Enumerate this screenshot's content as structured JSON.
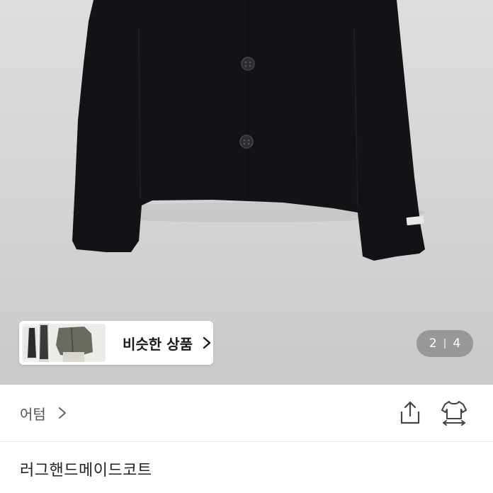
{
  "colors": {
    "jacket": "#121316",
    "hero_bg": "#d6d6d6",
    "pager_bg": "#6e6e6e",
    "text_primary": "#222222",
    "text_secondary": "#555555"
  },
  "gallery": {
    "current_page": "2",
    "separator": "|",
    "total_pages": "4"
  },
  "similar": {
    "label": "비슷한 상품",
    "chevron_icon": "chevron-right-icon"
  },
  "shop": {
    "name": "어텀",
    "chevron_icon": "chevron-right-icon",
    "share_icon": "share-icon",
    "tryon_icon": "clothing-swap-icon"
  },
  "product": {
    "title": "러그핸드메이드코트"
  }
}
